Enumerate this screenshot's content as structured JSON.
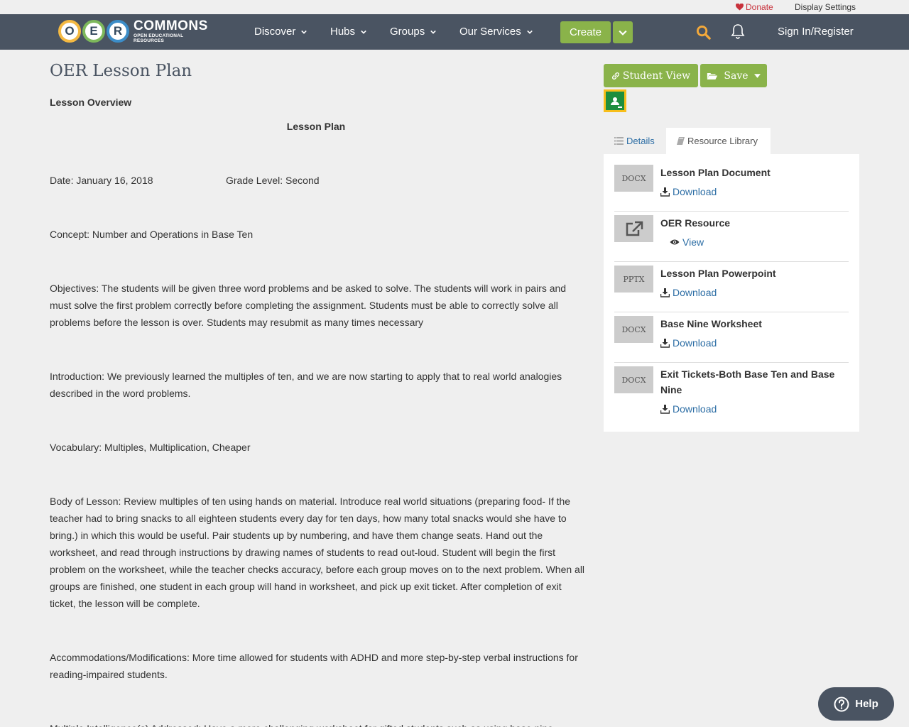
{
  "utility": {
    "donate": "Donate",
    "display_settings": "Display Settings"
  },
  "logo": {
    "letters": [
      "O",
      "E",
      "R"
    ],
    "name": "COMMONS",
    "tagline": "OPEN EDUCATIONAL RESOURCES"
  },
  "nav": {
    "items": [
      {
        "label": "Discover"
      },
      {
        "label": "Hubs"
      },
      {
        "label": "Groups"
      },
      {
        "label": "Our Services"
      }
    ],
    "create": "Create",
    "signin": "Sign In/Register"
  },
  "page": {
    "title": "OER Lesson Plan",
    "overview": "Lesson Overview",
    "lesson_heading": "Lesson Plan",
    "date": "Date: January 16, 2018",
    "grade": "Grade Level: Second",
    "concept": "Concept: Number and Operations in Base Ten",
    "objectives": "Objectives: The students will be given three word problems and be asked to solve. The students will work in pairs and must solve the first problem correctly before completing the assignment. Students must be able to correctly solve all problems before the lesson is over. Students may resubmit as many times necessary",
    "introduction": "Introduction: We previously learned the multiples of ten, and we are now starting to apply that to real world analogies described in the word problems.",
    "vocabulary": "Vocabulary: Multiples, Multiplication, Cheaper",
    "body": "Body of Lesson: Review multiples of ten using hands on material. Introduce real world situations (preparing food- If the teacher had to bring snacks to all eighteen students every day for ten days, how many total snacks would she have to bring.) in which this would be useful. Pair students up by numbering, and have them change seats. Hand out the worksheet, and read through instructions by drawing names of students to read out-loud. Student will begin the first problem on the worksheet, while the teacher checks accuracy, before each group moves on to the next problem. When all groups are finished, one student in each group will hand in worksheet, and pick up exit ticket. After completion of exit ticket, the lesson will be complete.",
    "accommodations": "Accommodations/Modifications: More time allowed for students with ADHD and more step-by-step verbal instructions for reading-impaired students.",
    "intelligences": "Multiple Intelligence(s) Addressed: Have a more challenging worksheet for gifted students such as using base nine"
  },
  "sidebar": {
    "student_view": "Student View",
    "save": "Save",
    "tabs": {
      "details": "Details",
      "library": "Resource Library"
    },
    "resources": [
      {
        "thumb": "DOCX",
        "title": "Lesson Plan Document",
        "action": "Download"
      },
      {
        "thumb": "external-link-icon",
        "title": "OER Resource",
        "action": "View"
      },
      {
        "thumb": "PPTX",
        "title": "Lesson Plan Powerpoint",
        "action": "Download"
      },
      {
        "thumb": "DOCX",
        "title": "Base Nine Worksheet",
        "action": "Download"
      },
      {
        "thumb": "DOCX",
        "title": "Exit Tickets-Both Base Ten and Base Nine",
        "action": "Download"
      }
    ]
  },
  "help": "Help",
  "colors": {
    "nav_bg": "#4a5462",
    "accent_green": "#8ab34a",
    "link_blue": "#2d6ea5",
    "donate_red": "#c8323c",
    "search_orange": "#f4a93a"
  }
}
